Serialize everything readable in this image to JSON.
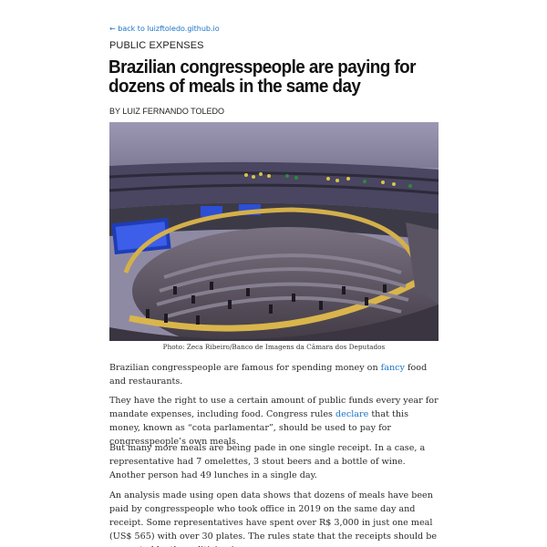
{
  "nav": {
    "back_link": "← back to luizftoledo.github.io"
  },
  "article": {
    "kicker": "PUBLIC EXPENSES",
    "title": "Brazilian congresspeople are paying for dozens of meals in the same day",
    "byline": "BY LUIZ FERNANDO TOLEDO",
    "photo_caption": "Photo: Zeca Ribeiro/Banco de Imagens da Câmara dos Deputados",
    "p1": {
      "before": "Brazilian congresspeople are famous for spending money on ",
      "link": "fancy",
      "after": " food and restaurants."
    },
    "p2": {
      "before": "They have the right to use a certain amount of public funds every year for mandate expenses, including food. Congress rules ",
      "link": "declare",
      "after": " that this money, known as “cota parlamentar”, should be used to pay for congresspeople’s own meals."
    },
    "p3": "But many more meals are being pade in one single receipt. In a case, a representative had 7 omelettes, 3 stout beers and a bottle of wine. Another person had 49 lunches in a single day.",
    "p4": "An analysis made using open data shows that dozens of meals have been paid by congresspeople who took office in 2019 on the same day and receipt. Some representatives have spent over R$ 3,000 in just one meal (US$ 565) with over 30 plates. The rules state that the receipts should be presented by the politician in"
  },
  "colors": {
    "link": "#1a73c7",
    "headline": "#111111",
    "text": "#2a2a2a"
  }
}
